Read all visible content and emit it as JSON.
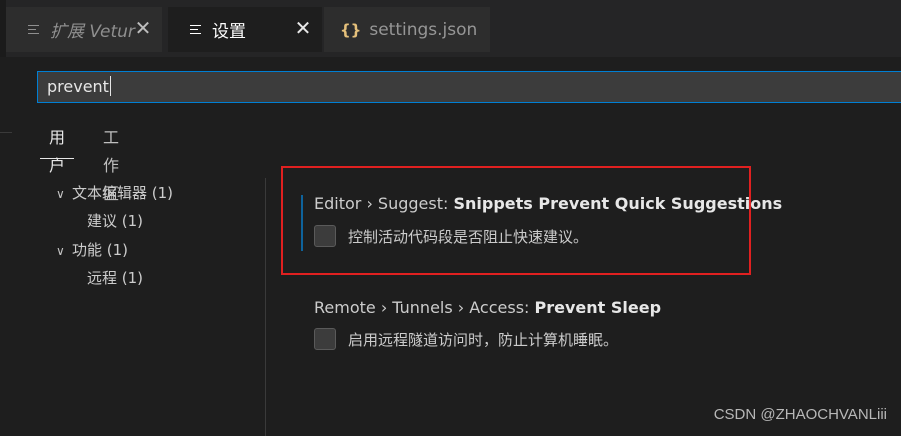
{
  "tabs": [
    {
      "label": "扩展 Vetur",
      "icon": "preview-lines-icon",
      "closable": true
    },
    {
      "label": "设置",
      "icon": "preview-lines-icon",
      "closable": true,
      "active": true
    },
    {
      "label": "settings.json",
      "icon": "json-braces-icon",
      "closable": false
    }
  ],
  "json_icon_glyph": "{}",
  "close_glyph": "✕",
  "search": {
    "value": "prevent"
  },
  "scope_tabs": [
    {
      "label": "用户",
      "active": true
    },
    {
      "label": "工作区"
    }
  ],
  "toc": [
    {
      "label": "文本编辑器 (1)",
      "expanded": true
    },
    {
      "label": "建议 (1)"
    },
    {
      "label": "功能 (1)",
      "expanded": true
    },
    {
      "label": "远程 (1)"
    }
  ],
  "settings": [
    {
      "category": "Editor › Suggest: ",
      "name": "Snippets Prevent Quick Suggestions",
      "description": "控制活动代码段是否阻止快速建议。",
      "checked": false,
      "highlighted": true
    },
    {
      "category": "Remote › Tunnels › Access: ",
      "name": "Prevent Sleep",
      "description": "启用远程隧道访问时，防止计算机睡眠。",
      "checked": false
    }
  ],
  "watermark": "CSDN @ZHAOCHVANLiii",
  "colors": {
    "accent": "#007fd4",
    "highlight_box": "#e02020",
    "json_icon": "#e5c07b"
  }
}
